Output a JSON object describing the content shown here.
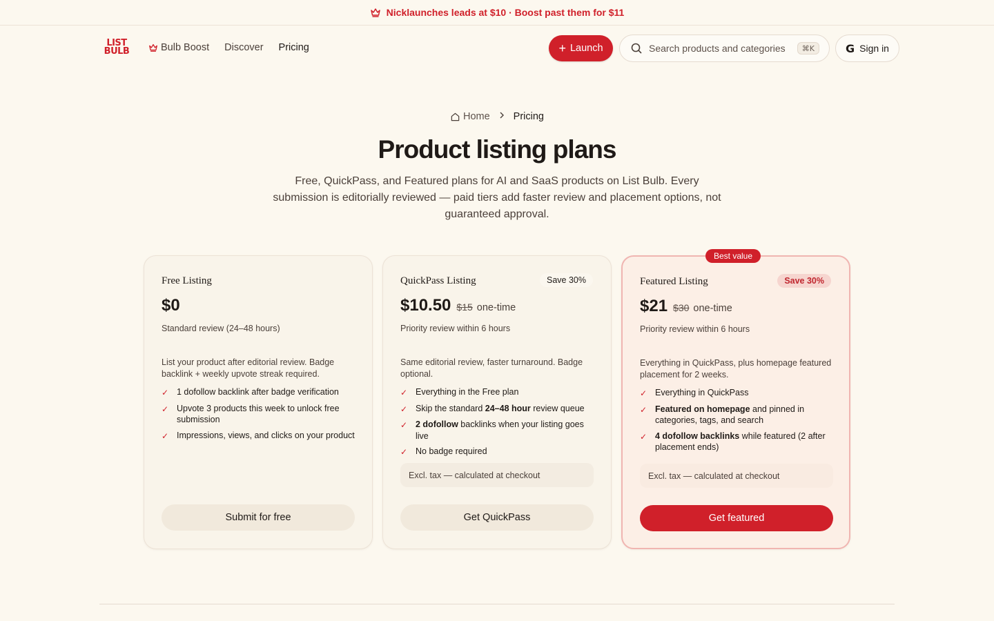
{
  "announcement": {
    "text": "Nicklaunches leads at $10 · Boost past them for $11",
    "icon": "crown-icon"
  },
  "header": {
    "logo_top": "LIST",
    "logo_bottom": "BULB",
    "nav": [
      {
        "label": "Bulb Boost",
        "icon": "crown-icon"
      },
      {
        "label": "Discover"
      },
      {
        "label": "Pricing",
        "active": true
      }
    ],
    "launch_label": "Launch",
    "search_placeholder": "Search products and categories",
    "search_shortcut": "⌘K",
    "signin_label": "Sign in"
  },
  "breadcrumb": {
    "home": "Home",
    "current": "Pricing"
  },
  "page": {
    "title": "Product listing plans",
    "subtitle": "Free, QuickPass, and Featured plans for AI and SaaS products on List Bulb. Every submission is editorially reviewed — paid tiers add faster review and placement options, not guaranteed approval."
  },
  "plans": [
    {
      "name": "Free Listing",
      "price": "$0",
      "review": "Standard review (24–48 hours)",
      "description": "List your product after editorial review. Badge backlink + weekly upvote streak required.",
      "features": [
        "1 dofollow backlink after badge verification",
        "Upvote 3 products this week to unlock free submission",
        "Impressions, views, and clicks on your product"
      ],
      "cta": "Submit for free"
    },
    {
      "name": "QuickPass Listing",
      "badge": "Save 30%",
      "price": "$10.50",
      "old_price": "$15",
      "price_note": "one-time",
      "review": "Priority review within 6 hours",
      "description": "Same editorial review, faster turnaround. Badge optional.",
      "features": [
        {
          "pre": "Everything in the Free plan",
          "bold": "",
          "post": ""
        },
        {
          "pre": "Skip the standard ",
          "bold": "24–48 hour",
          "post": " review queue"
        },
        {
          "pre": "",
          "bold": "2 dofollow",
          "post": " backlinks when your listing goes live"
        },
        {
          "pre": "No badge required",
          "bold": "",
          "post": ""
        }
      ],
      "tax": "Excl. tax — calculated at checkout",
      "cta": "Get QuickPass"
    },
    {
      "name": "Featured Listing",
      "ribbon": "Best value",
      "badge": "Save 30%",
      "price": "$21",
      "old_price": "$30",
      "price_note": "one-time",
      "review": "Priority review within 6 hours",
      "description": "Everything in QuickPass, plus homepage featured placement for 2 weeks.",
      "features": [
        {
          "pre": "Everything in QuickPass",
          "bold": "",
          "post": ""
        },
        {
          "pre": "",
          "bold": "Featured on homepage",
          "post": " and pinned in categories, tags, and search"
        },
        {
          "pre": "",
          "bold": "4 dofollow backlinks",
          "post": " while featured (2 after placement ends)"
        }
      ],
      "tax": "Excl. tax — calculated at checkout",
      "cta": "Get featured"
    }
  ],
  "colors": {
    "accent": "#d0202a",
    "background": "#fcf8ef",
    "text": "#1f1a17"
  }
}
